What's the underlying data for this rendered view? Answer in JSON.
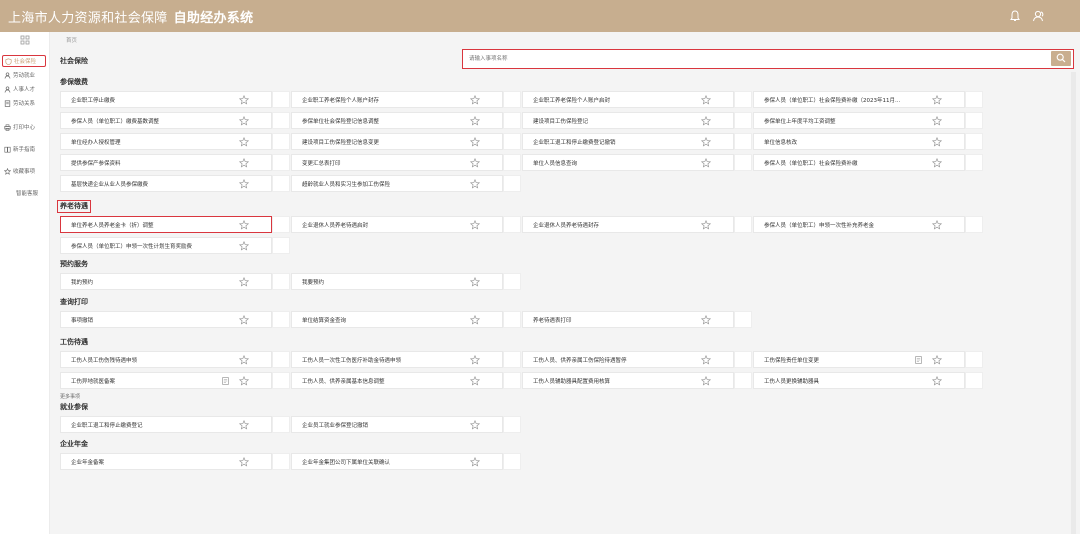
{
  "header": {
    "title": "上海市人力资源和社会保障",
    "subtitle": "自助经办系统",
    "icons": [
      "bell-icon",
      "user-icon"
    ]
  },
  "sidebar": {
    "items": [
      {
        "label": "社会保险",
        "icon": "shield-icon",
        "active": true
      },
      {
        "label": "劳动就业",
        "icon": "person-icon"
      },
      {
        "label": "人事人才",
        "icon": "person-icon"
      },
      {
        "label": "劳动关系",
        "icon": "doc-icon"
      },
      {
        "label": "打印中心",
        "icon": "printer-icon"
      },
      {
        "label": "新手指南",
        "icon": "book-icon"
      },
      {
        "label": "收藏事项",
        "icon": "star-icon"
      },
      {
        "label": "智能客服",
        "icon": ""
      }
    ]
  },
  "breadcrumb": "首页",
  "page_title": "社会保险",
  "search": {
    "placeholder": "请输入事项名称"
  },
  "colors": {
    "header": "#c7ae8f",
    "accent": "#c9a27a",
    "highlight": "#d9363e"
  },
  "more_label": "更多事项",
  "sections": [
    {
      "title": "参保缴费",
      "items": [
        "企业职工停止缴费",
        "企业职工养老保险个人账户封存",
        "企业职工养老保险个人账户启封",
        "参保人员（单位职工）社会保险费补缴（2023年11月...",
        "参保人员（单位职工）缴费基数调整",
        "参保单位社会保险登记信息调整",
        "建设项目工伤保险登记",
        "参保单位上年度平均工资调整",
        "单位经办人授权管理",
        "建设项目工伤保险登记信息变更",
        "企业职工退工和停止缴费登记撤销",
        "单位信息核改",
        "提供参保产参保资料",
        "变更汇总表打印",
        "单位人员信息查询",
        "参保人员（单位职工）社会保险费补缴",
        "基层快递企业从业人员参保缴费",
        "超龄就业人员和实习生参加工伤保险"
      ]
    },
    {
      "title": "养老待遇",
      "items": [
        "单位养老人员养老金卡（折）调整",
        "企业退休人员养老待遇启封",
        "企业退休人员养老待遇封存",
        "参保人员（单位职工）申领一次性补充养老金",
        "参保人员（单位职工）申领一次性计划生育奖励费"
      ]
    },
    {
      "title": "预约服务",
      "items": [
        "我的预约",
        "我要预约"
      ]
    },
    {
      "title": "查询打印",
      "items": [
        "事项撤销",
        "单位结算资金查询",
        "养老待遇表打印"
      ]
    },
    {
      "title": "工伤待遇",
      "items": [
        "工伤人员工伤伤残待遇申领",
        "工伤人员一次性工伤医疗补助金待遇申领",
        "工伤人员、供养亲属工伤保险待遇暂停",
        "工伤保险责任单位变更",
        "工伤异地就医备案",
        "工伤人员、供养亲属基本信息调整",
        "工伤人员辅助器具配置费用核算",
        "工伤人员更换辅助器具"
      ]
    },
    {
      "title": "就业参保",
      "items": [
        "企业职工退工和停止缴费登记",
        "企业员工就业参保登记撤销"
      ]
    },
    {
      "title": "企业年金",
      "items": [
        "企业年金备案",
        "企业年金集团公司下属单位关联确认"
      ]
    }
  ]
}
